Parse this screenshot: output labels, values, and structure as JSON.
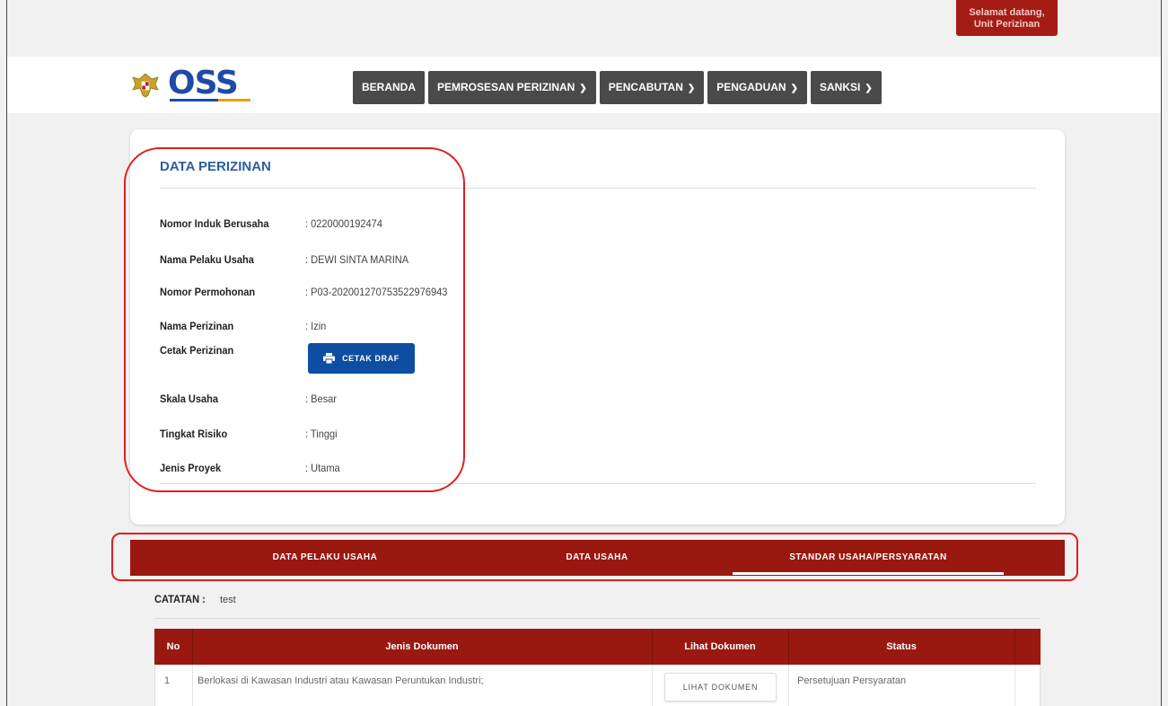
{
  "header": {
    "welcome_line1": "Selamat datang,",
    "welcome_line2": "Unit Perizinan",
    "logo_text": "OSS"
  },
  "nav": {
    "items": [
      {
        "label": "BERANDA",
        "dropdown": false
      },
      {
        "label": "PEMROSESAN PERIZINAN",
        "dropdown": true
      },
      {
        "label": "PENCABUTAN",
        "dropdown": true
      },
      {
        "label": "PENGADUAN",
        "dropdown": true
      },
      {
        "label": "SANKSI",
        "dropdown": true
      }
    ]
  },
  "data_perizinan": {
    "title": "DATA PERIZINAN",
    "rows": [
      {
        "label": "Nomor Induk Berusaha",
        "value": ": 0220000192474"
      },
      {
        "label": "Nama Pelaku Usaha",
        "value": ": DEWI SINTA MARINA"
      },
      {
        "label": "Nomor Permohonan",
        "value": ": P03-202001270753522976943"
      },
      {
        "label": "Nama Perizinan",
        "value": ": Izin"
      },
      {
        "label": "Cetak Perizinan",
        "value": ""
      },
      {
        "label": "Skala Usaha",
        "value": ": Besar"
      },
      {
        "label": "Tingkat Risiko",
        "value": ": Tinggi"
      },
      {
        "label": "Jenis Proyek",
        "value": ": Utama"
      }
    ],
    "cetak_button": "CETAK DRAF"
  },
  "tabs": [
    {
      "label": "DATA PELAKU USAHA",
      "active": false
    },
    {
      "label": "DATA USAHA",
      "active": false
    },
    {
      "label": "STANDAR USAHA/PERSYARATAN",
      "active": true
    }
  ],
  "catatan": {
    "label": "CATATAN :",
    "value": "test"
  },
  "table": {
    "headers": [
      "No",
      "Jenis Dokumen",
      "Lihat Dokumen",
      "Status"
    ],
    "rows": [
      {
        "no": "1",
        "jenis": "Berlokasi di Kawasan Industri atau Kawasan Peruntukan Industri;",
        "button": "LIHAT DOKUMEN",
        "status": "Persetujuan Persyaratan"
      }
    ]
  },
  "colors": {
    "brand_red": "#99180f",
    "nav_gray": "#4a4a4a",
    "primary_blue": "#0d4ea3",
    "title_blue": "#2a5fa0",
    "highlight_red": "#e01e1e"
  }
}
